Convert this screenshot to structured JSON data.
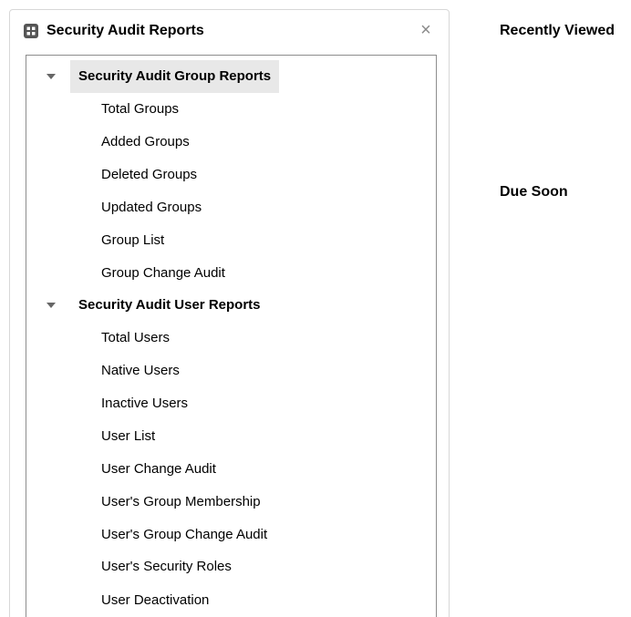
{
  "panel": {
    "title": "Security Audit Reports",
    "icon": "report-grid-icon",
    "close_label": "×"
  },
  "tree": {
    "groups": [
      {
        "label": "Security Audit Group Reports",
        "expanded": true,
        "selected": true,
        "items": [
          "Total Groups",
          "Added Groups",
          "Deleted Groups",
          "Updated Groups",
          "Group List",
          "Group Change Audit"
        ]
      },
      {
        "label": "Security Audit User Reports",
        "expanded": true,
        "selected": false,
        "items": [
          "Total Users",
          "Native Users",
          "Inactive Users",
          "User List",
          "User Change Audit",
          "User's Group Membership",
          "User's Group Change Audit",
          "User's Security Roles",
          "User Deactivation"
        ]
      }
    ]
  },
  "sidebar": {
    "recently_viewed": "Recently Viewed",
    "due_soon": "Due Soon"
  }
}
